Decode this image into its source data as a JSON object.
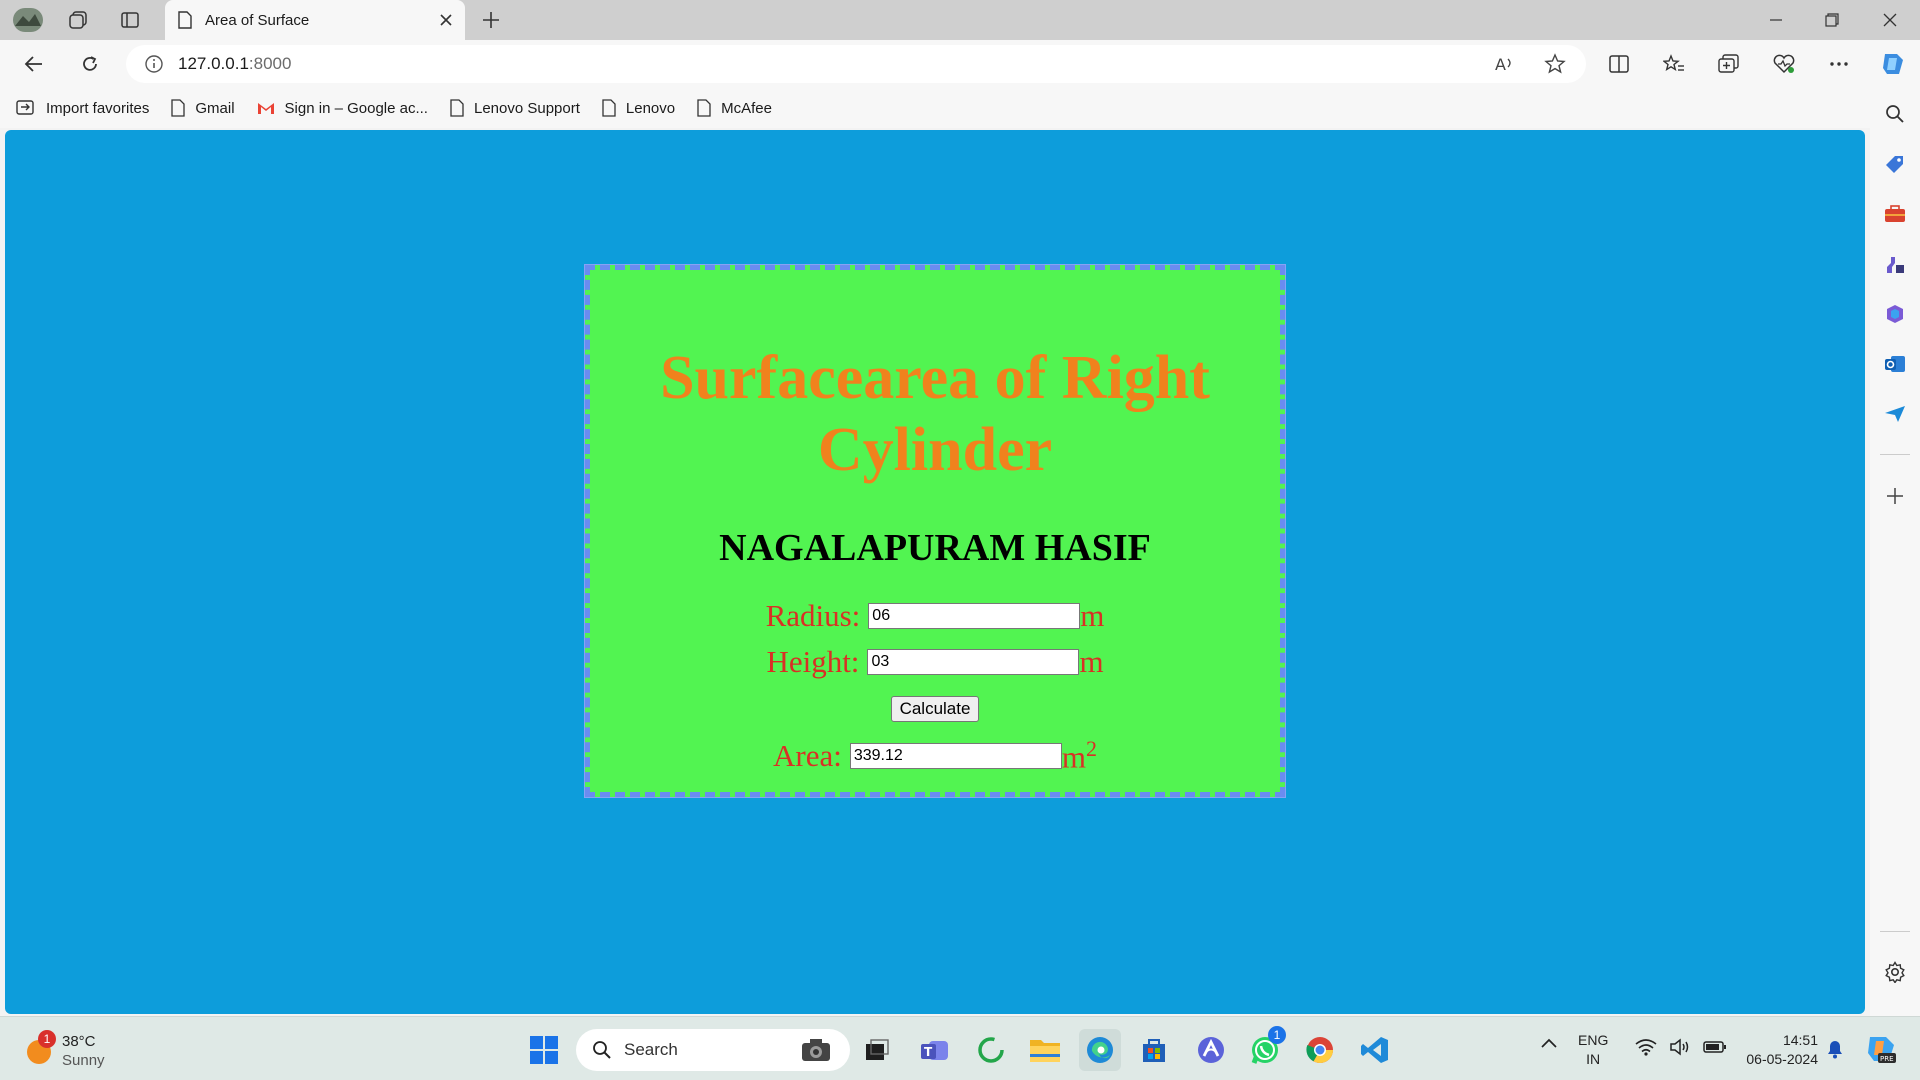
{
  "browser": {
    "tab_title": "Area of Surface",
    "url_host": "127.0.0.1",
    "url_port": ":8000"
  },
  "favorites": [
    {
      "label": "Import favorites"
    },
    {
      "label": "Gmail"
    },
    {
      "label": "Sign in – Google ac..."
    },
    {
      "label": "Lenovo Support"
    },
    {
      "label": "Lenovo"
    },
    {
      "label": "McAfee"
    }
  ],
  "page": {
    "title": "Surfacearea of Right Cylinder",
    "author": "NAGALAPURAM HASIF",
    "radius_label": "Radius:",
    "radius_value": "06",
    "radius_unit": "m",
    "height_label": "Height:",
    "height_value": "03",
    "height_unit": "m",
    "calculate_label": "Calculate",
    "area_label": "Area:",
    "area_value": "339.12",
    "area_unit": "m",
    "area_unit_exp": "2"
  },
  "taskbar": {
    "weather_temp": "38°C",
    "weather_desc": "Sunny",
    "weather_badge": "1",
    "search_placeholder": "Search",
    "whatsapp_badge": "1",
    "lang_line1": "ENG",
    "lang_line2": "IN",
    "time": "14:51",
    "date": "06-05-2024"
  },
  "colors": {
    "page_bg": "#0d9ddb",
    "card_bg": "#52f451",
    "title": "#f0821d",
    "label": "#d93025"
  }
}
